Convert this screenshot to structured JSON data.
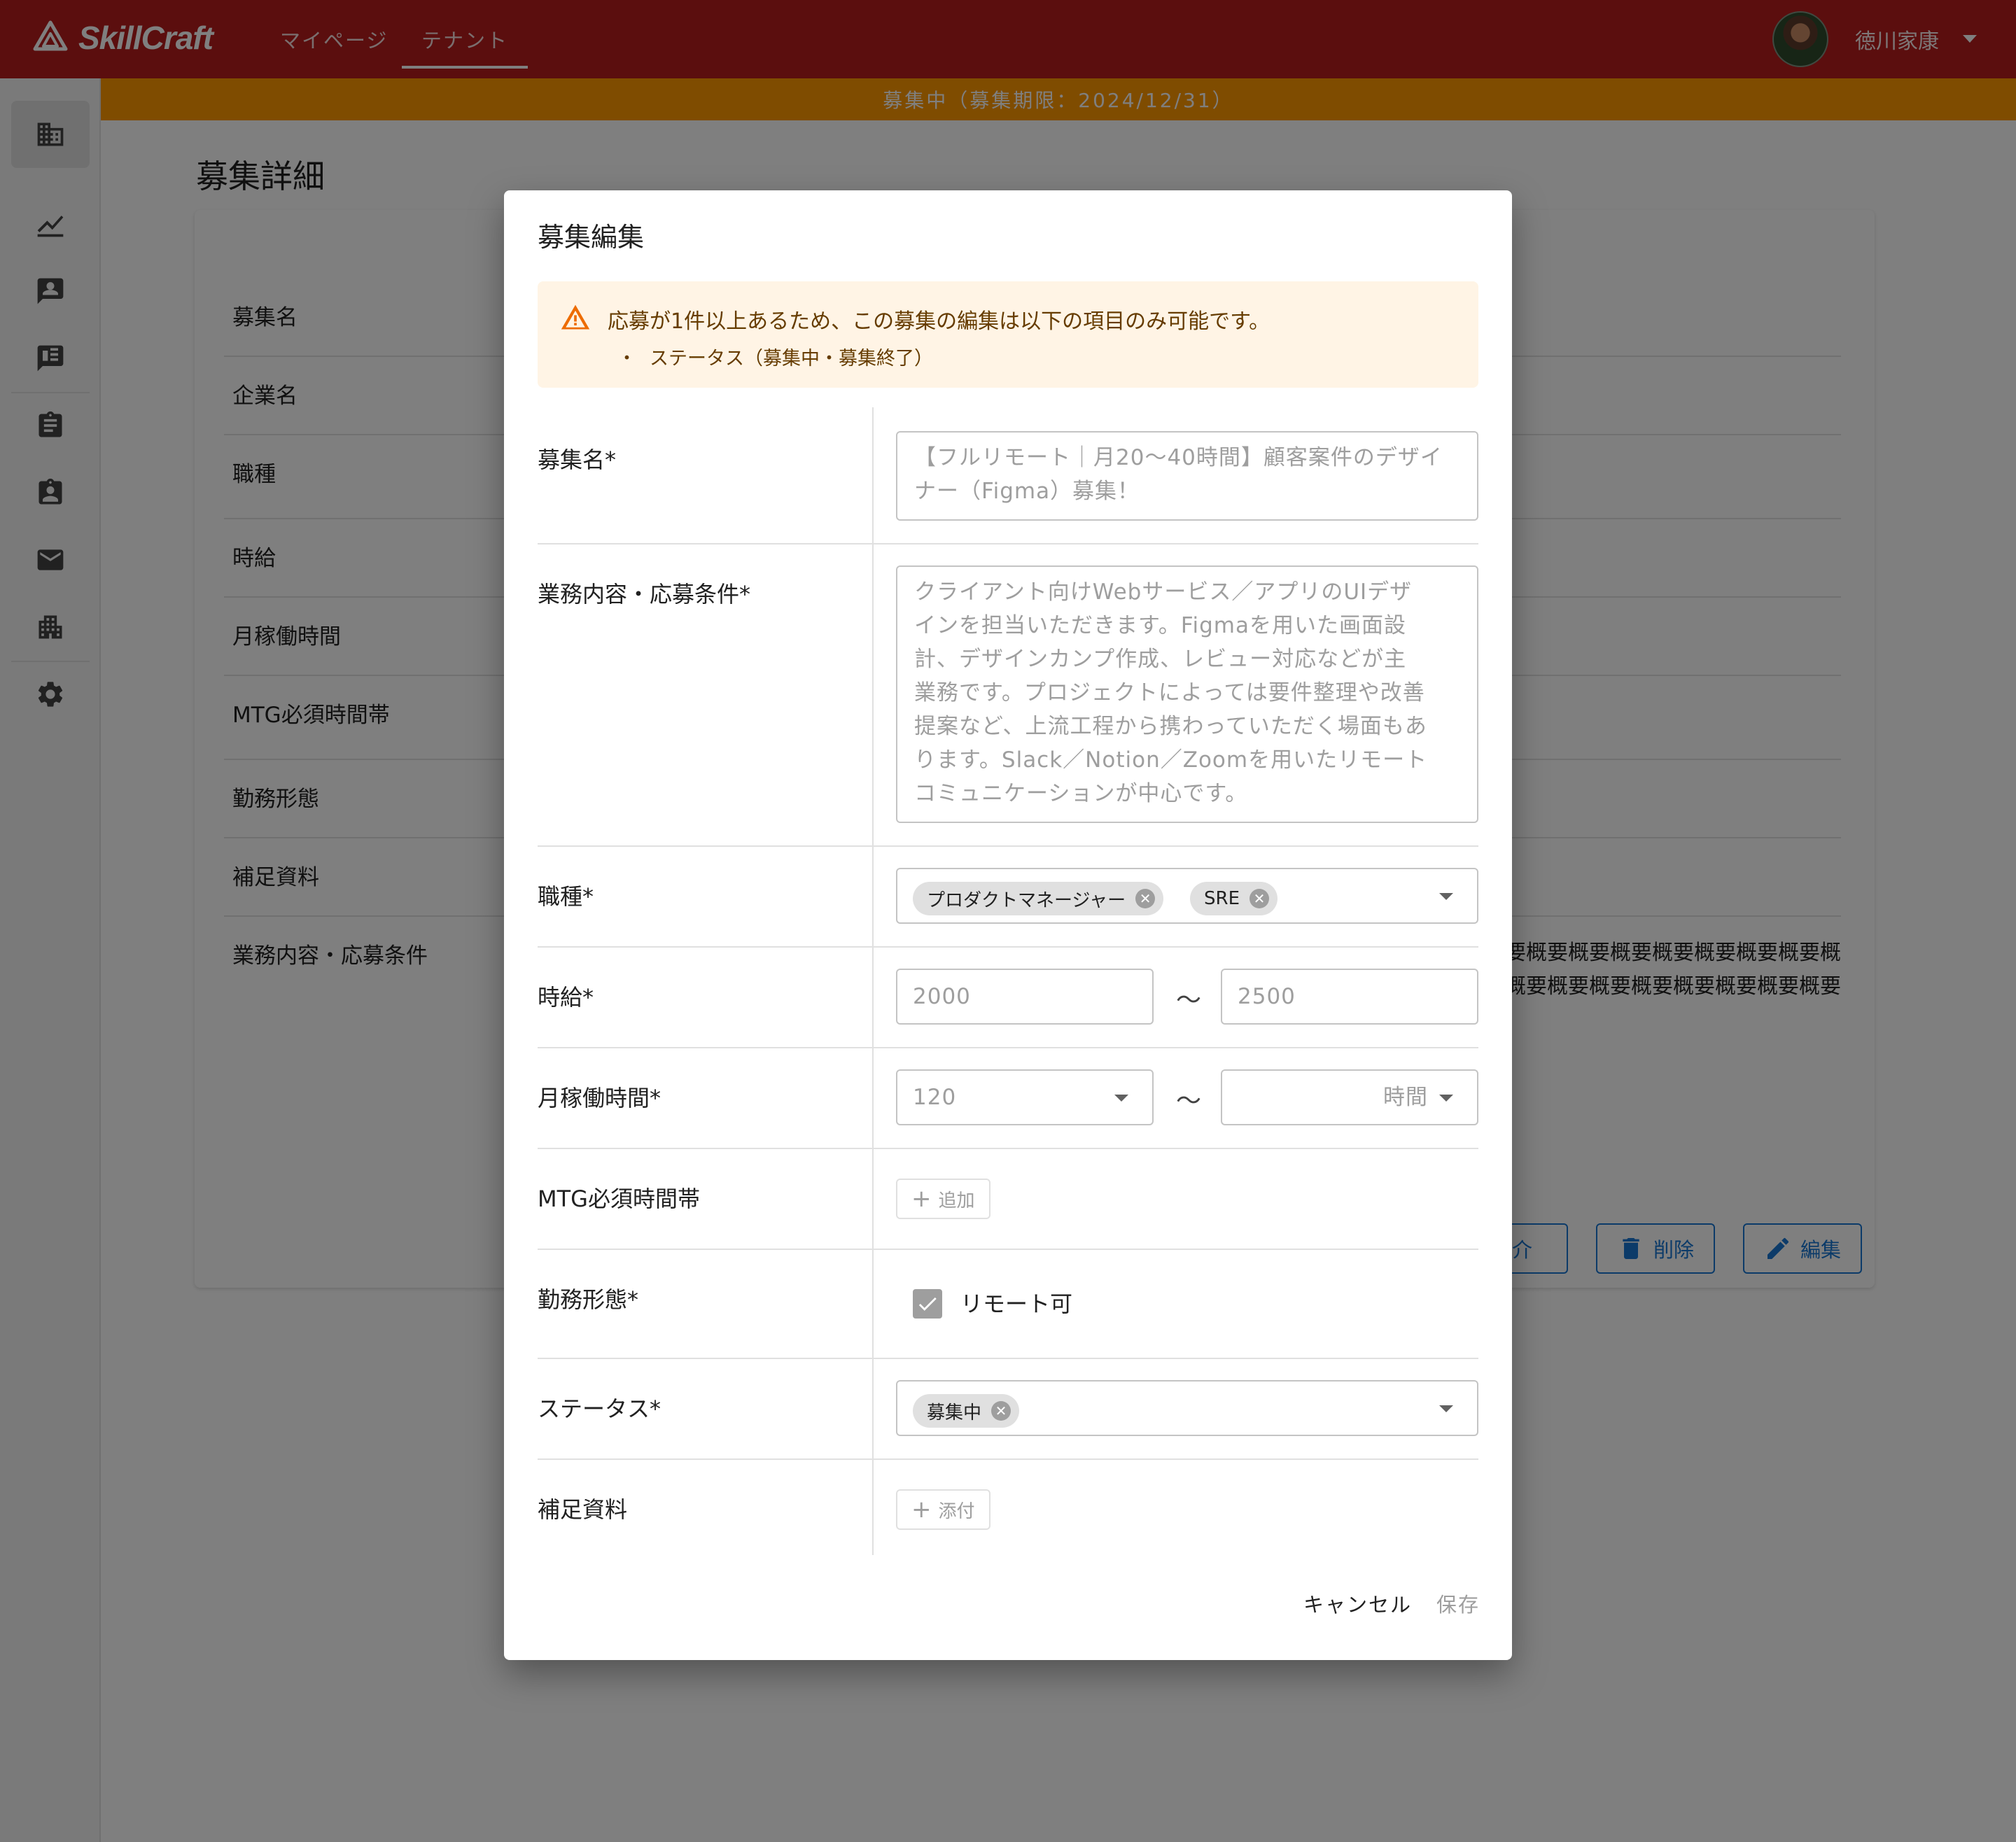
{
  "header": {
    "logo_text": "SkillCraft",
    "nav": [
      "マイページ",
      "テナント"
    ],
    "user_name": "徳川家康"
  },
  "banner": {
    "text": "募集中（募集期限：2024/12/31）"
  },
  "page": {
    "title": "募集詳細",
    "detail_labels": [
      "募集名",
      "企業名",
      "職種",
      "時給",
      "月稼働時間",
      "MTG必須時間帯",
      "勤務形態",
      "補足資料",
      "業務内容・応募条件"
    ],
    "description_lines": [
      "要概要概要概要概要概要概要概要概",
      "概要概要概要概要概要概要概要概要"
    ],
    "buttons": {
      "introduce": "紹介",
      "delete": "削除",
      "edit": "編集"
    }
  },
  "dialog": {
    "title": "募集編集",
    "alert": {
      "message": "応募が1件以上あるため、この募集の編集は以下の項目のみ可能です。",
      "bullet": "・",
      "item": "ステータス（募集中・募集終了）"
    },
    "fields": {
      "name": {
        "label": "募集名*",
        "lines": [
          "【フルリモート｜月20〜40時間】顧客案件のデザイ",
          "ナー（Figma）募集！"
        ]
      },
      "description": {
        "label": "業務内容・応募条件*",
        "lines": [
          "クライアント向けWebサービス／アプリのUIデザ",
          "インを担当いただきます。Figmaを用いた画面設",
          "計、デザインカンプ作成、レビュー対応などが主",
          "業務です。プロジェクトによっては要件整理や改善",
          "提案など、上流工程から携わっていただく場面もあ",
          "ります。Slack／Notion／Zoomを用いたリモート",
          "コミュニケーションが中心です。"
        ]
      },
      "job_type": {
        "label": "職種*",
        "chips": [
          "プロダクトマネージャー",
          "SRE"
        ]
      },
      "hourly_rate": {
        "label": "時給*",
        "min": "2000",
        "max": "2500",
        "separator": "〜"
      },
      "monthly_hours": {
        "label": "月稼働時間*",
        "min": "120",
        "max_placeholder": "時間",
        "separator": "〜"
      },
      "mtg_time": {
        "label": "MTG必須時間帯",
        "add_label": "追加"
      },
      "work_style": {
        "label": "勤務形態*",
        "checkbox_label": "リモート可",
        "checked": true
      },
      "status": {
        "label": "ステータス*",
        "chips": [
          "募集中"
        ]
      },
      "attachments": {
        "label": "補足資料",
        "attach_label": "添付"
      }
    },
    "actions": {
      "cancel": "キャンセル",
      "save": "保存"
    }
  },
  "colors": {
    "header": "#b71c1c",
    "banner": "#ff9800",
    "primary": "#1976d2",
    "alert_bg": "#fff4e5",
    "alert_icon": "#ed6c02"
  },
  "icons": [
    "logo-icon",
    "building-icon",
    "chart-icon",
    "person-card-icon",
    "chat-icon",
    "clipboard-icon",
    "badge-icon",
    "mail-icon",
    "apartment-icon",
    "gear-icon",
    "warning-icon",
    "trash-icon",
    "pencil-icon",
    "check-icon"
  ]
}
